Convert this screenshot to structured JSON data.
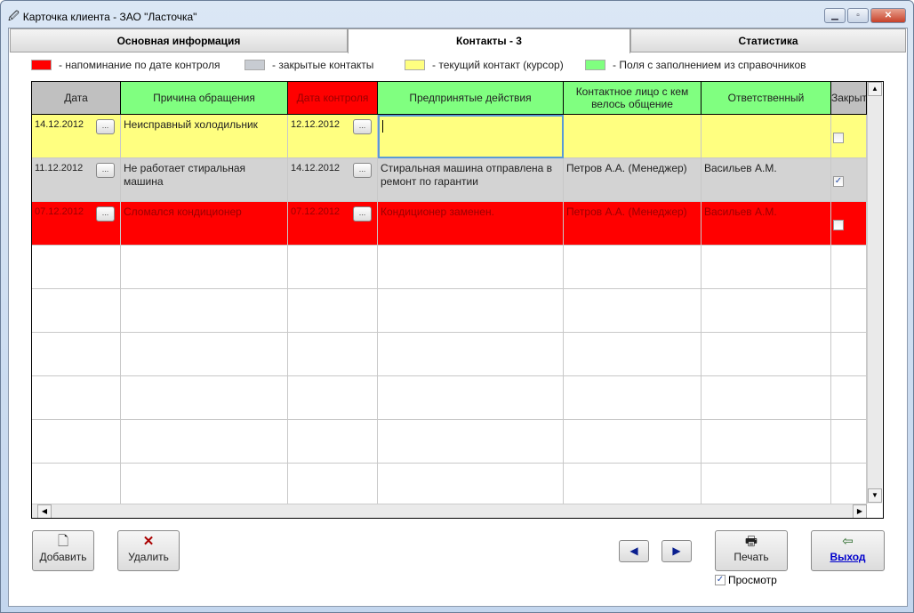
{
  "window": {
    "title": "Карточка клиента  -  ЗАО \"Ласточка\"",
    "minimize": "▁",
    "maximize": "▫",
    "close": "✕"
  },
  "tabs": [
    {
      "label": "Основная информация"
    },
    {
      "label": "Контакты - 3"
    },
    {
      "label": "Статистика"
    }
  ],
  "legend": [
    {
      "color": "#ff0000",
      "label": "- напоминание по дате контроля"
    },
    {
      "color": "#c8ccd2",
      "label": "- закрытые контакты"
    },
    {
      "color": "#ffff80",
      "label": "- текущий контакт (курсор)"
    },
    {
      "color": "#80ff80",
      "label": "-  Поля с заполнением из справочников"
    }
  ],
  "columns": [
    "Дата",
    "Причина обращения",
    "Дата контроля",
    "Предпринятые действия",
    "Контактное лицо с кем велось общение",
    "Ответственный",
    "Закрыт"
  ],
  "rows": [
    {
      "date": "14.12.2012",
      "reason": "Неисправный холодильник",
      "control": "12.12.2012",
      "actions": "",
      "contact": "",
      "responsible": "",
      "closed": false,
      "state": "current"
    },
    {
      "date": "11.12.2012",
      "reason": "Не работает стиральная машина",
      "control": "14.12.2012",
      "actions": "Стиральная машина отправлена в ремонт по гарантии",
      "contact": "Петров А.А. (Менеджер)",
      "responsible": "Васильев А.М.",
      "closed": true,
      "state": "closed"
    },
    {
      "date": "07.12.2012",
      "reason": "Сломался кондиционер",
      "control": "07.12.2012",
      "actions": "Кондиционер заменен.",
      "contact": "Петров А.А. (Менеджер)",
      "responsible": "Васильев А.М.",
      "closed": false,
      "state": "reminder"
    }
  ],
  "colors": {
    "current": "#ffff80",
    "closed": "#d3d3d3",
    "reminder": "#ff0000",
    "reminder_text": "#9a0000",
    "lookup": "#80ff80",
    "header_gray": "#c0c0c0"
  },
  "buttons": {
    "add": "Добавить",
    "delete": "Удалить",
    "print": "Печать",
    "exit": "Выход",
    "preview": "Просмотр",
    "preview_checked": true,
    "dots": "..."
  }
}
